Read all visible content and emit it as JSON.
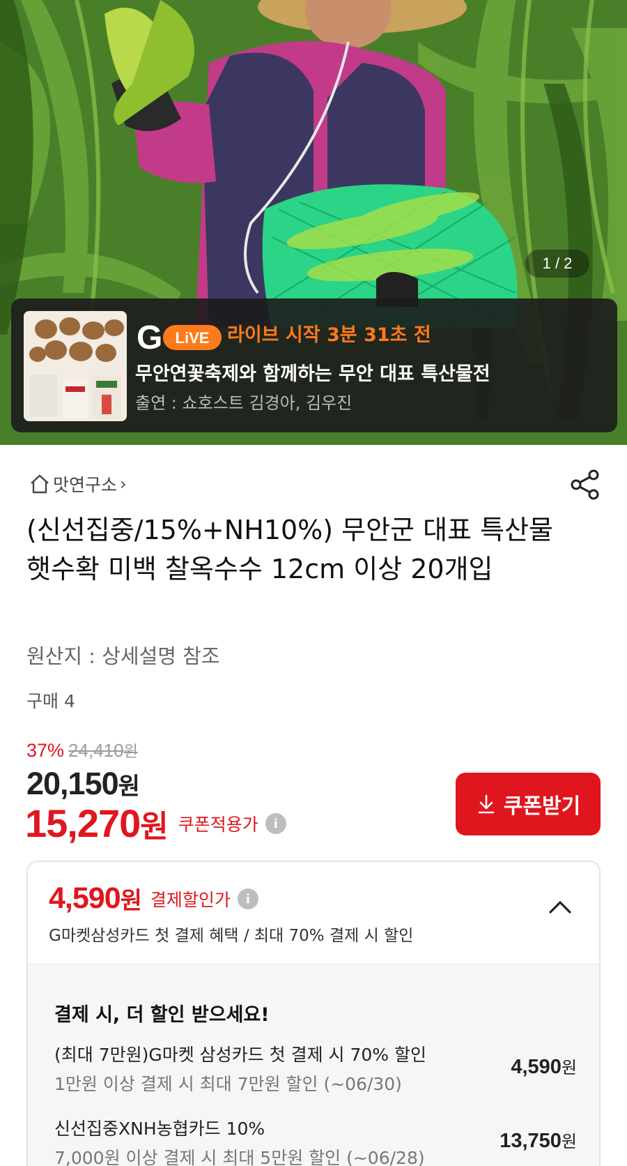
{
  "hero": {
    "page_indicator": "1 / 2"
  },
  "live": {
    "logo_g": "G",
    "logo_live": "LiVE",
    "status": "라이브 시작 3분 31초 전",
    "title": "무안연꽃축제와 함께하는 무안 대표 특산물전",
    "cast": "출연 : 쇼호스트 김경아, 김우진"
  },
  "breadcrumb": {
    "label": "맛연구소",
    "chevron": "›",
    "home_icon": "home-icon"
  },
  "share_icon": "share-icon",
  "product": {
    "title": "(신선집중/15%+NH10%) 무안군 대표 특산물 햇수확 미백 찰옥수수 12cm 이상 20개입",
    "origin": "원산지 : 상세설명 참조",
    "purchase_count": "구매 4"
  },
  "price": {
    "discount_rate": "37%",
    "original_price": "24,410",
    "original_won": "원",
    "sale_price": "20,150",
    "sale_won": "원",
    "coupon_price": "15,270",
    "coupon_won": "원",
    "coupon_label": "쿠폰적용가",
    "info_glyph": "i"
  },
  "coupon_button": {
    "label": "쿠폰받기",
    "icon": "download-icon"
  },
  "payment": {
    "price": "4,590",
    "won": "원",
    "label": "결제할인가",
    "info_glyph": "i",
    "summary": "G마켓삼성카드 첫 결제 혜택 / 최대 70% 결제 시 할인",
    "expanded_title": "결제 시, 더 할인 받으세요!",
    "benefits": [
      {
        "name": "(최대 7만원)G마켓 삼성카드 첫 결제 시 70% 할인",
        "condition": "1만원 이상 결제 시 최대 7만원 할인 (~06/30)",
        "amount": "4,590",
        "won": "원"
      },
      {
        "name": "신선집중XNH농협카드 10%",
        "condition": "7,000원 이상 결제 시 최대 5만원 할인 (~06/28)",
        "amount": "13,750",
        "won": "원"
      }
    ]
  },
  "colors": {
    "accent_red": "#e0161e",
    "live_orange": "#ff7a1a",
    "live_card_bg": "#1c1c1c"
  }
}
